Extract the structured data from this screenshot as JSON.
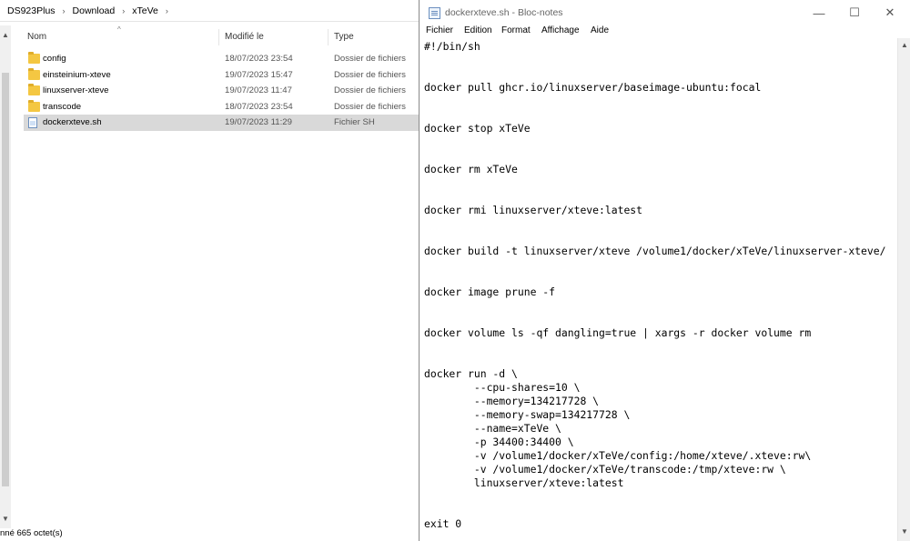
{
  "explorer": {
    "breadcrumb": [
      "DS923Plus",
      "Download",
      "xTeVe"
    ],
    "columns": {
      "name": "Nom",
      "modified": "Modifié le",
      "type": "Type"
    },
    "files": [
      {
        "name": "config",
        "date": "18/07/2023 23:54",
        "type": "Dossier de fichiers",
        "kind": "folder"
      },
      {
        "name": "einsteinium-xteve",
        "date": "19/07/2023 15:47",
        "type": "Dossier de fichiers",
        "kind": "folder"
      },
      {
        "name": "linuxserver-xteve",
        "date": "19/07/2023 11:47",
        "type": "Dossier de fichiers",
        "kind": "folder"
      },
      {
        "name": "transcode",
        "date": "18/07/2023 23:54",
        "type": "Dossier de fichiers",
        "kind": "folder"
      },
      {
        "name": "dockerxteve.sh",
        "date": "19/07/2023 11:29",
        "type": "Fichier SH",
        "kind": "file",
        "selected": true
      }
    ],
    "status": "nné  665 octet(s)"
  },
  "notepad": {
    "title": "dockerxteve.sh - Bloc-notes",
    "menu": [
      "Fichier",
      "Edition",
      "Format",
      "Affichage",
      "Aide"
    ],
    "content": "#!/bin/sh\n\n\ndocker pull ghcr.io/linuxserver/baseimage-ubuntu:focal\n\n\ndocker stop xTeVe\n\n\ndocker rm xTeVe\n\n\ndocker rmi linuxserver/xteve:latest\n\n\ndocker build -t linuxserver/xteve /volume1/docker/xTeVe/linuxserver-xteve/\n\n\ndocker image prune -f\n\n\ndocker volume ls -qf dangling=true | xargs -r docker volume rm\n\n\ndocker run -d \\\n        --cpu-shares=10 \\\n        --memory=134217728 \\\n        --memory-swap=134217728 \\\n        --name=xTeVe \\\n        -p 34400:34400 \\\n        -v /volume1/docker/xTeVe/config:/home/xteve/.xteve:rw\\\n        -v /volume1/docker/xTeVe/transcode:/tmp/xteve:rw \\\n        linuxserver/xteve:latest\n\n\nexit 0"
  },
  "icons": {
    "minimize": "—",
    "maximize": "☐",
    "close": "✕",
    "up": "▲",
    "down": "▼",
    "chevron": "›",
    "sort": "^"
  }
}
